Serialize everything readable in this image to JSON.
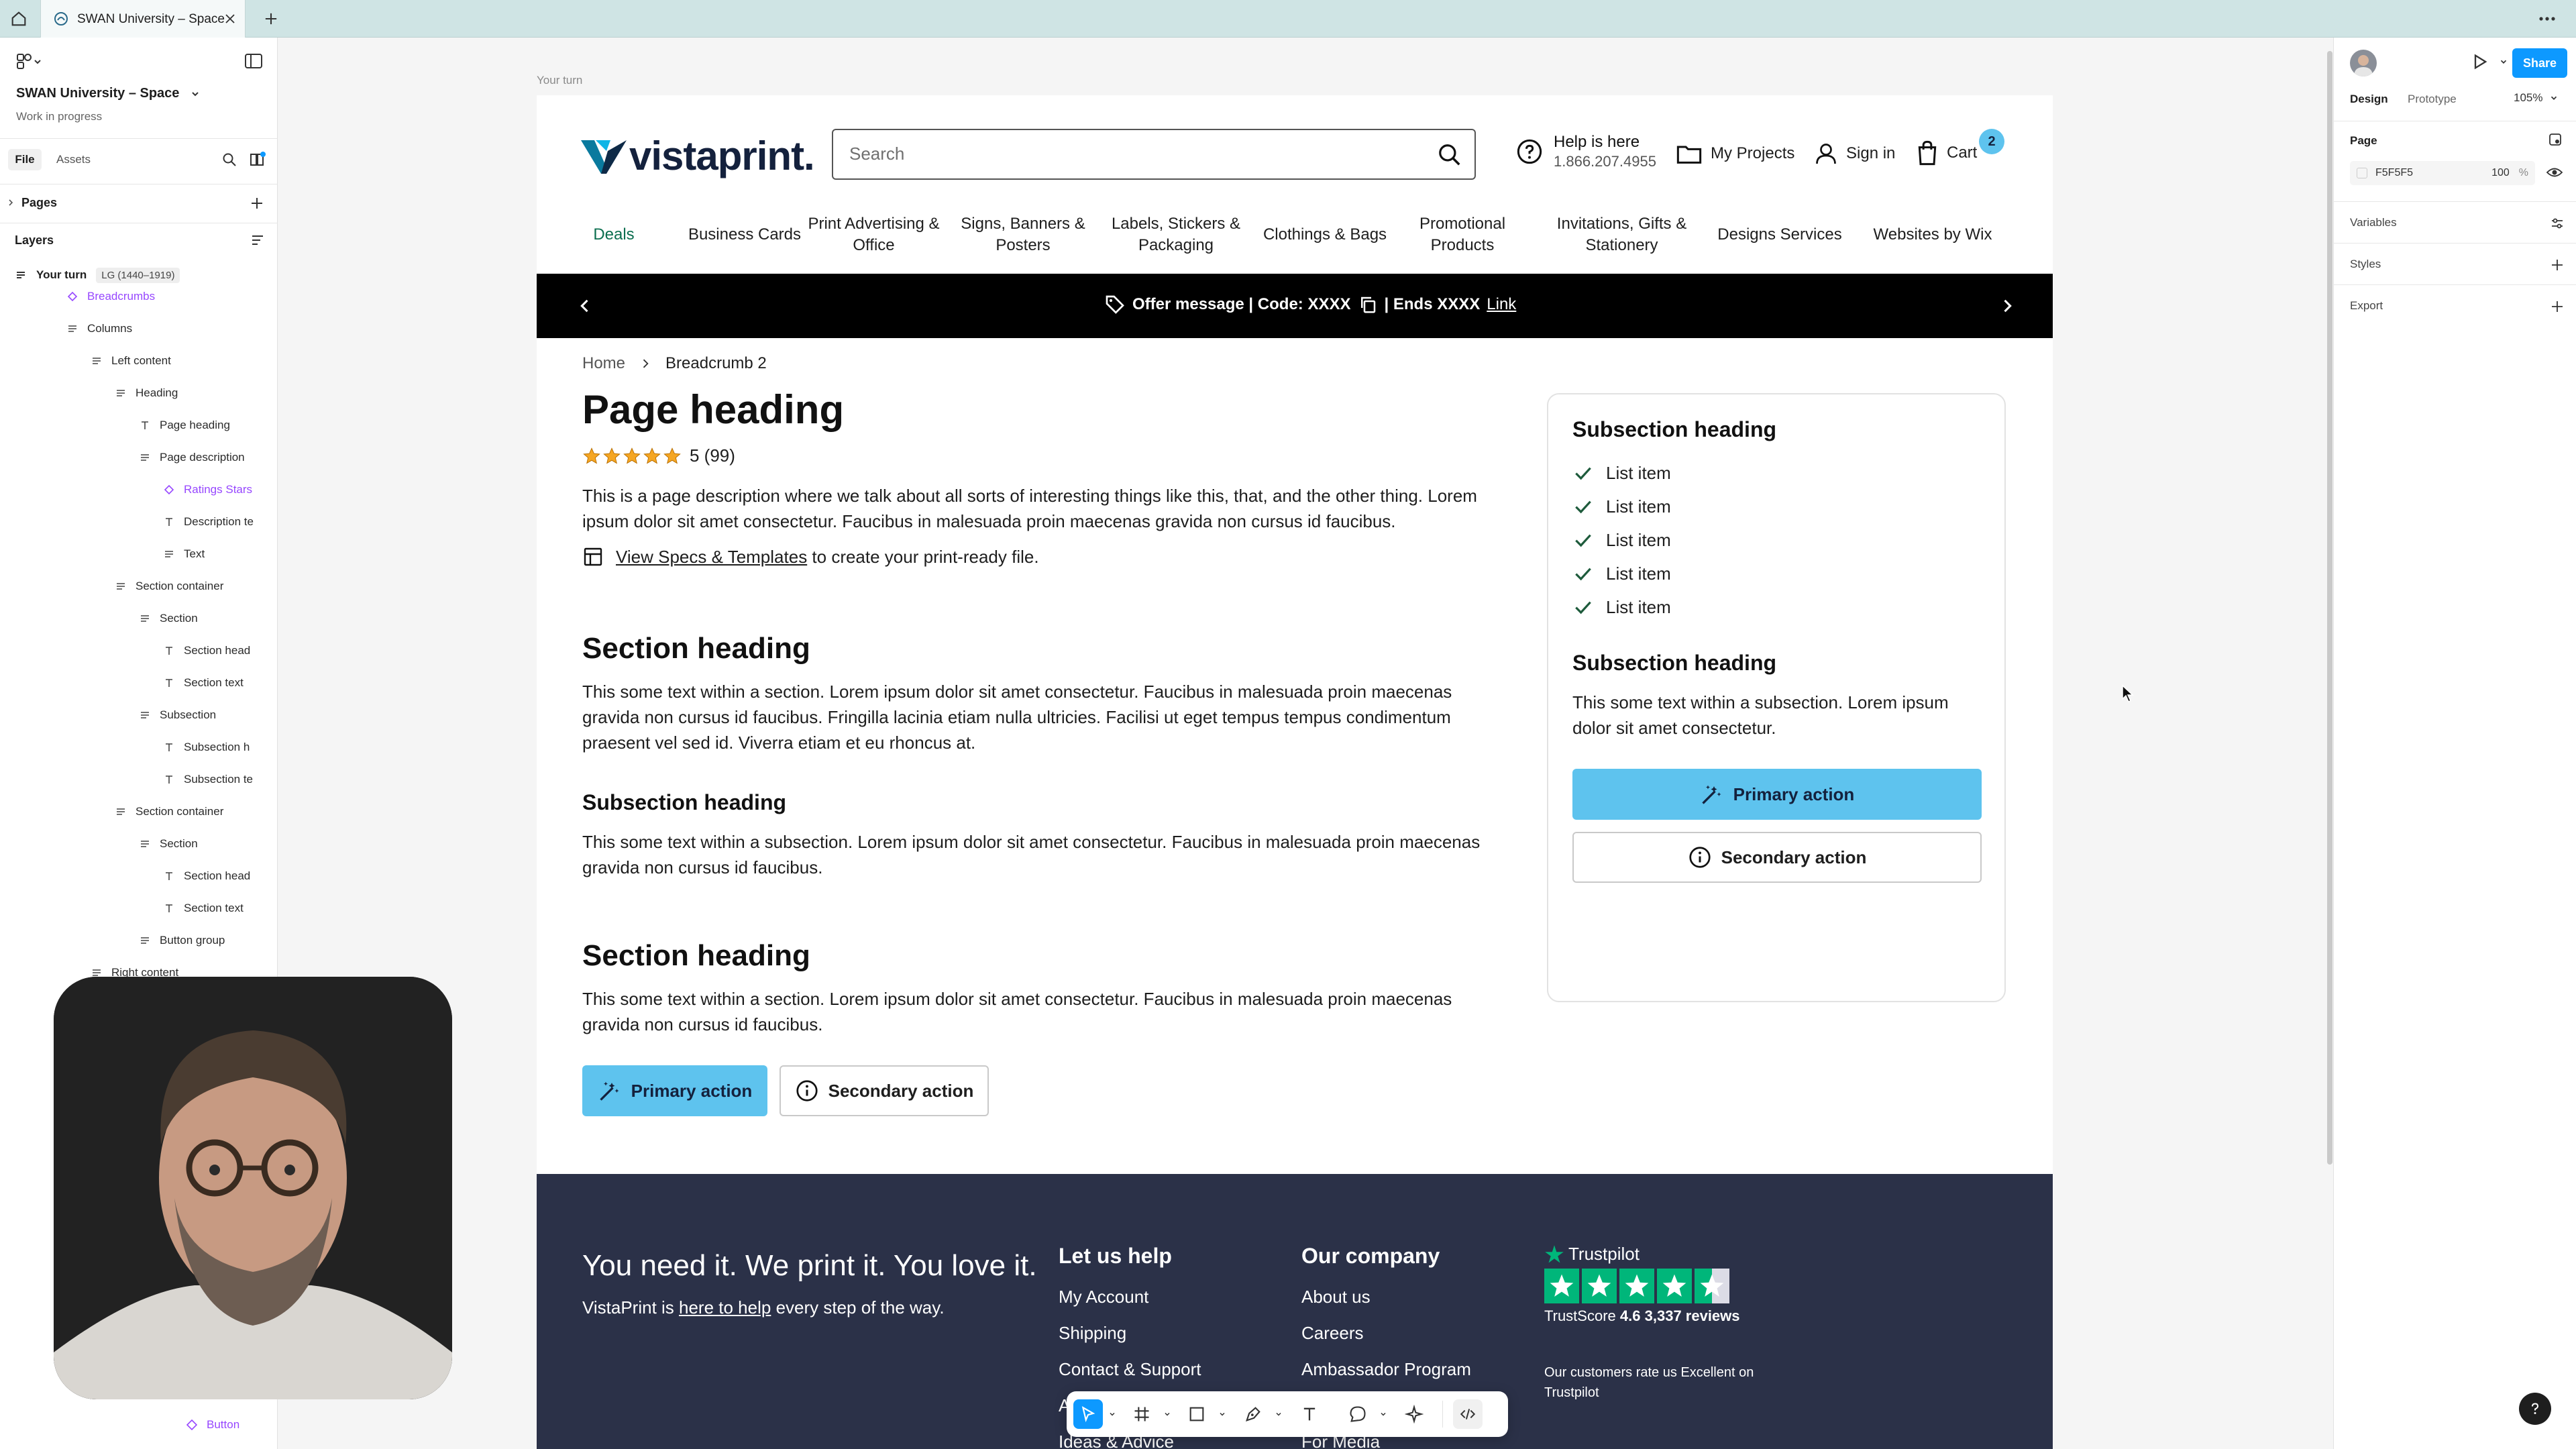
{
  "browser": {
    "tab_title": "SWAN University – Space"
  },
  "left_panel": {
    "file_name": "SWAN University – Space",
    "status": "Work in progress",
    "tabs": [
      "File",
      "Assets"
    ],
    "pages_label": "Pages",
    "layers_label": "Layers",
    "root_layer": "Your turn",
    "root_badge": "LG (1440–1919)",
    "layers": [
      {
        "label": "Breadcrumbs",
        "indent": 1,
        "kind": "component"
      },
      {
        "label": "Columns",
        "indent": 1,
        "kind": "frame"
      },
      {
        "label": "Left content",
        "indent": 2,
        "kind": "frame"
      },
      {
        "label": "Heading",
        "indent": 3,
        "kind": "frame"
      },
      {
        "label": "Page heading",
        "indent": 4,
        "kind": "text"
      },
      {
        "label": "Page description",
        "indent": 4,
        "kind": "frame"
      },
      {
        "label": "Ratings Stars",
        "indent": 5,
        "kind": "component"
      },
      {
        "label": "Description te",
        "indent": 5,
        "kind": "text"
      },
      {
        "label": "Text",
        "indent": 5,
        "kind": "frame"
      },
      {
        "label": "Section container",
        "indent": 3,
        "kind": "frame"
      },
      {
        "label": "Section",
        "indent": 4,
        "kind": "frame"
      },
      {
        "label": "Section head",
        "indent": 5,
        "kind": "text"
      },
      {
        "label": "Section text",
        "indent": 5,
        "kind": "text"
      },
      {
        "label": "Subsection",
        "indent": 4,
        "kind": "frame"
      },
      {
        "label": "Subsection h",
        "indent": 5,
        "kind": "text"
      },
      {
        "label": "Subsection te",
        "indent": 5,
        "kind": "text"
      },
      {
        "label": "Section container",
        "indent": 3,
        "kind": "frame"
      },
      {
        "label": "Section",
        "indent": 4,
        "kind": "frame"
      },
      {
        "label": "Section head",
        "indent": 5,
        "kind": "text"
      },
      {
        "label": "Section text",
        "indent": 5,
        "kind": "text"
      },
      {
        "label": "Button group",
        "indent": 4,
        "kind": "frame"
      },
      {
        "label": "Right content",
        "indent": 2,
        "kind": "frame"
      }
    ],
    "bottom_layer": "Button"
  },
  "right_panel": {
    "tabs": [
      "Design",
      "Prototype"
    ],
    "zoom": "105%",
    "share_label": "Share",
    "page_label": "Page",
    "page_color": "F5F5F5",
    "page_opacity": "100",
    "page_opacity_unit": "%",
    "sections": [
      "Variables",
      "Styles",
      "Export"
    ]
  },
  "canvas": {
    "frame_label": "Your turn"
  },
  "site": {
    "logo_text": "vistaprint.",
    "search_placeholder": "Search",
    "help_title": "Help is here",
    "help_phone": "1.866.207.4955",
    "my_projects": "My Projects",
    "sign_in": "Sign in",
    "cart": "Cart",
    "cart_count": "2",
    "nav": [
      "Deals",
      "Business Cards",
      "Print Advertising & Office",
      "Signs, Banners & Posters",
      "Labels, Stickers & Packaging",
      "Clothings & Bags",
      "Promotional Products",
      "Invitations, Gifts & Stationery",
      "Designs Services",
      "Websites by Wix"
    ],
    "promo": {
      "text": "Offer message | Code: XXXX",
      "ends": "| Ends XXXX",
      "link": "Link"
    },
    "breadcrumb": [
      "Home",
      "Breadcrumb 2"
    ],
    "page_heading": "Page heading",
    "rating_value": 5,
    "rating_text": "5 (99)",
    "description": "This is a page description where we talk about all sorts of interesting things like this, that, and the other thing. Lorem ipsum dolor sit amet consectetur. Faucibus in malesuada proin maecenas gravida non cursus id faucibus.",
    "specs_link": "View Specs & Templates",
    "specs_rest": " to create your print-ready file.",
    "section1_heading": "Section heading",
    "section1_text": "This some text within a section. Lorem ipsum dolor sit amet consectetur. Faucibus in malesuada proin maecenas gravida non cursus id faucibus. Fringilla lacinia etiam nulla ultricies. Facilisi ut eget tempus tempus condimentum praesent vel sed id. Viverra etiam et eu rhoncus at.",
    "sub1_heading": "Subsection heading",
    "sub1_text": "This some text within a subsection. Lorem ipsum dolor sit amet consectetur. Faucibus in malesuada proin maecenas gravida non cursus id faucibus.",
    "section2_heading": "Section heading",
    "section2_text": "This some text within a section. Lorem ipsum dolor sit amet consectetur. Faucibus in malesuada proin maecenas gravida non cursus id faucibus.",
    "primary_action": "Primary action",
    "secondary_action": "Secondary action",
    "card": {
      "heading1": "Subsection heading",
      "items": [
        "List item",
        "List item",
        "List item",
        "List item",
        "List item"
      ],
      "heading2": "Subsection heading",
      "text": "This some text within a subsection. Lorem ipsum dolor sit amet consectetur.",
      "primary": "Primary action",
      "secondary": "Secondary action"
    },
    "footer": {
      "tagline": "You need it. We print it. You love it.",
      "sub_before": "VistaPrint is ",
      "sub_link": "here to help",
      "sub_after": " every step of the way.",
      "col1_title": "Let us help",
      "col1": [
        "My Account",
        "Shipping",
        "Contact & Support",
        "A",
        "Ideas & Advice"
      ],
      "col2_title": "Our company",
      "col2": [
        "About us",
        "Careers",
        "Ambassador Program",
        "",
        "For Media"
      ],
      "trustpilot": "Trustpilot",
      "trustscore_label": "TrustScore",
      "trustscore_value": "4.6",
      "reviews": "3,337 reviews",
      "stars": 4.5,
      "rating_note": "Our customers rate us Excellent on Trustpilot"
    }
  },
  "colors": {
    "accent": "#5ec3ee",
    "figma_blue": "#0d99ff",
    "footer_bg": "#2b3148",
    "promo_bg": "#000000",
    "trustpilot_green": "#00b67a",
    "star_orange": "#f5a623",
    "deals_green": "#0b6e4f"
  }
}
